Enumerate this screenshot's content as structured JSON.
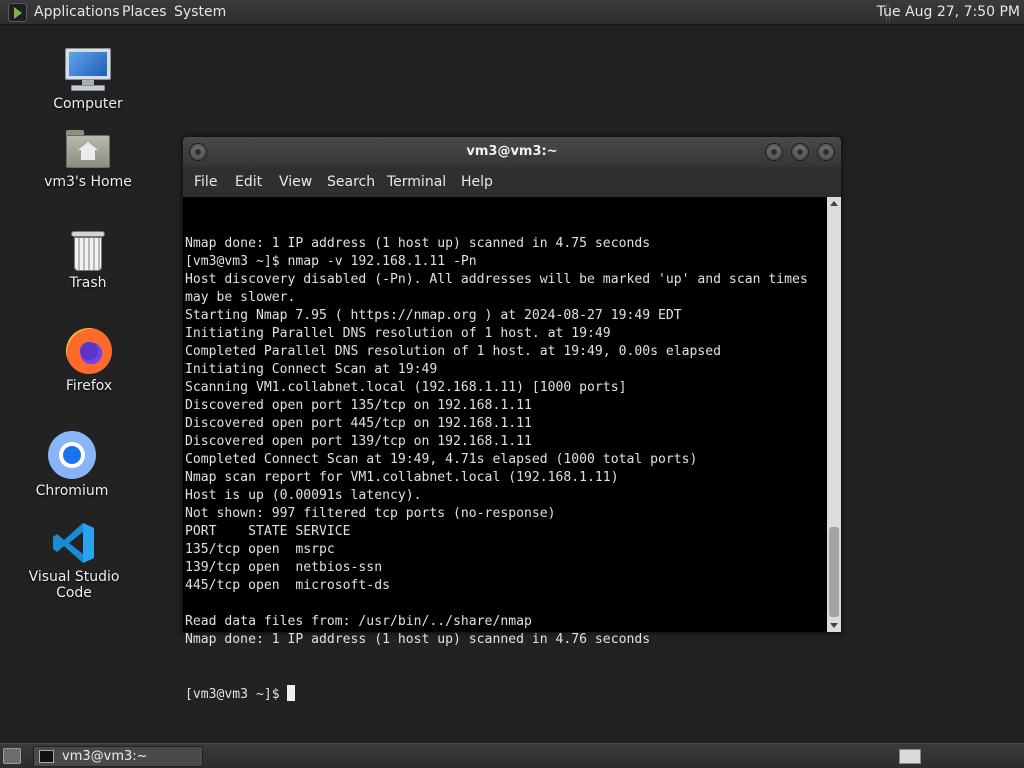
{
  "top_panel": {
    "menus": [
      "Applications",
      "Places",
      "System"
    ],
    "clock": "Tue Aug 27,  7:50 PM"
  },
  "desktop": {
    "icons": [
      {
        "label": "Computer",
        "icon": "computer-icon"
      },
      {
        "label": "vm3's Home",
        "icon": "home-folder-icon"
      },
      {
        "label": "Trash",
        "icon": "trash-icon"
      },
      {
        "label": "Firefox",
        "icon": "firefox-icon"
      },
      {
        "label": "Chromium",
        "icon": "chromium-icon"
      },
      {
        "label": "Visual Studio Code",
        "icon": "vscode-icon"
      }
    ]
  },
  "terminal": {
    "title": "vm3@vm3:~",
    "menu": [
      "File",
      "Edit",
      "View",
      "Search",
      "Terminal",
      "Help"
    ],
    "lines": [
      "Nmap done: 1 IP address (1 host up) scanned in 4.75 seconds",
      "[vm3@vm3 ~]$ nmap -v 192.168.1.11 -Pn",
      "Host discovery disabled (-Pn). All addresses will be marked 'up' and scan times",
      "may be slower.",
      "Starting Nmap 7.95 ( https://nmap.org ) at 2024-08-27 19:49 EDT",
      "Initiating Parallel DNS resolution of 1 host. at 19:49",
      "Completed Parallel DNS resolution of 1 host. at 19:49, 0.00s elapsed",
      "Initiating Connect Scan at 19:49",
      "Scanning VM1.collabnet.local (192.168.1.11) [1000 ports]",
      "Discovered open port 135/tcp on 192.168.1.11",
      "Discovered open port 445/tcp on 192.168.1.11",
      "Discovered open port 139/tcp on 192.168.1.11",
      "Completed Connect Scan at 19:49, 4.71s elapsed (1000 total ports)",
      "Nmap scan report for VM1.collabnet.local (192.168.1.11)",
      "Host is up (0.00091s latency).",
      "Not shown: 997 filtered tcp ports (no-response)",
      "PORT    STATE SERVICE",
      "135/tcp open  msrpc",
      "139/tcp open  netbios-ssn",
      "445/tcp open  microsoft-ds",
      "",
      "Read data files from: /usr/bin/../share/nmap",
      "Nmap done: 1 IP address (1 host up) scanned in 4.76 seconds"
    ],
    "prompt": "[vm3@vm3 ~]$ "
  },
  "taskbar": {
    "task_label": "vm3@vm3:~"
  }
}
